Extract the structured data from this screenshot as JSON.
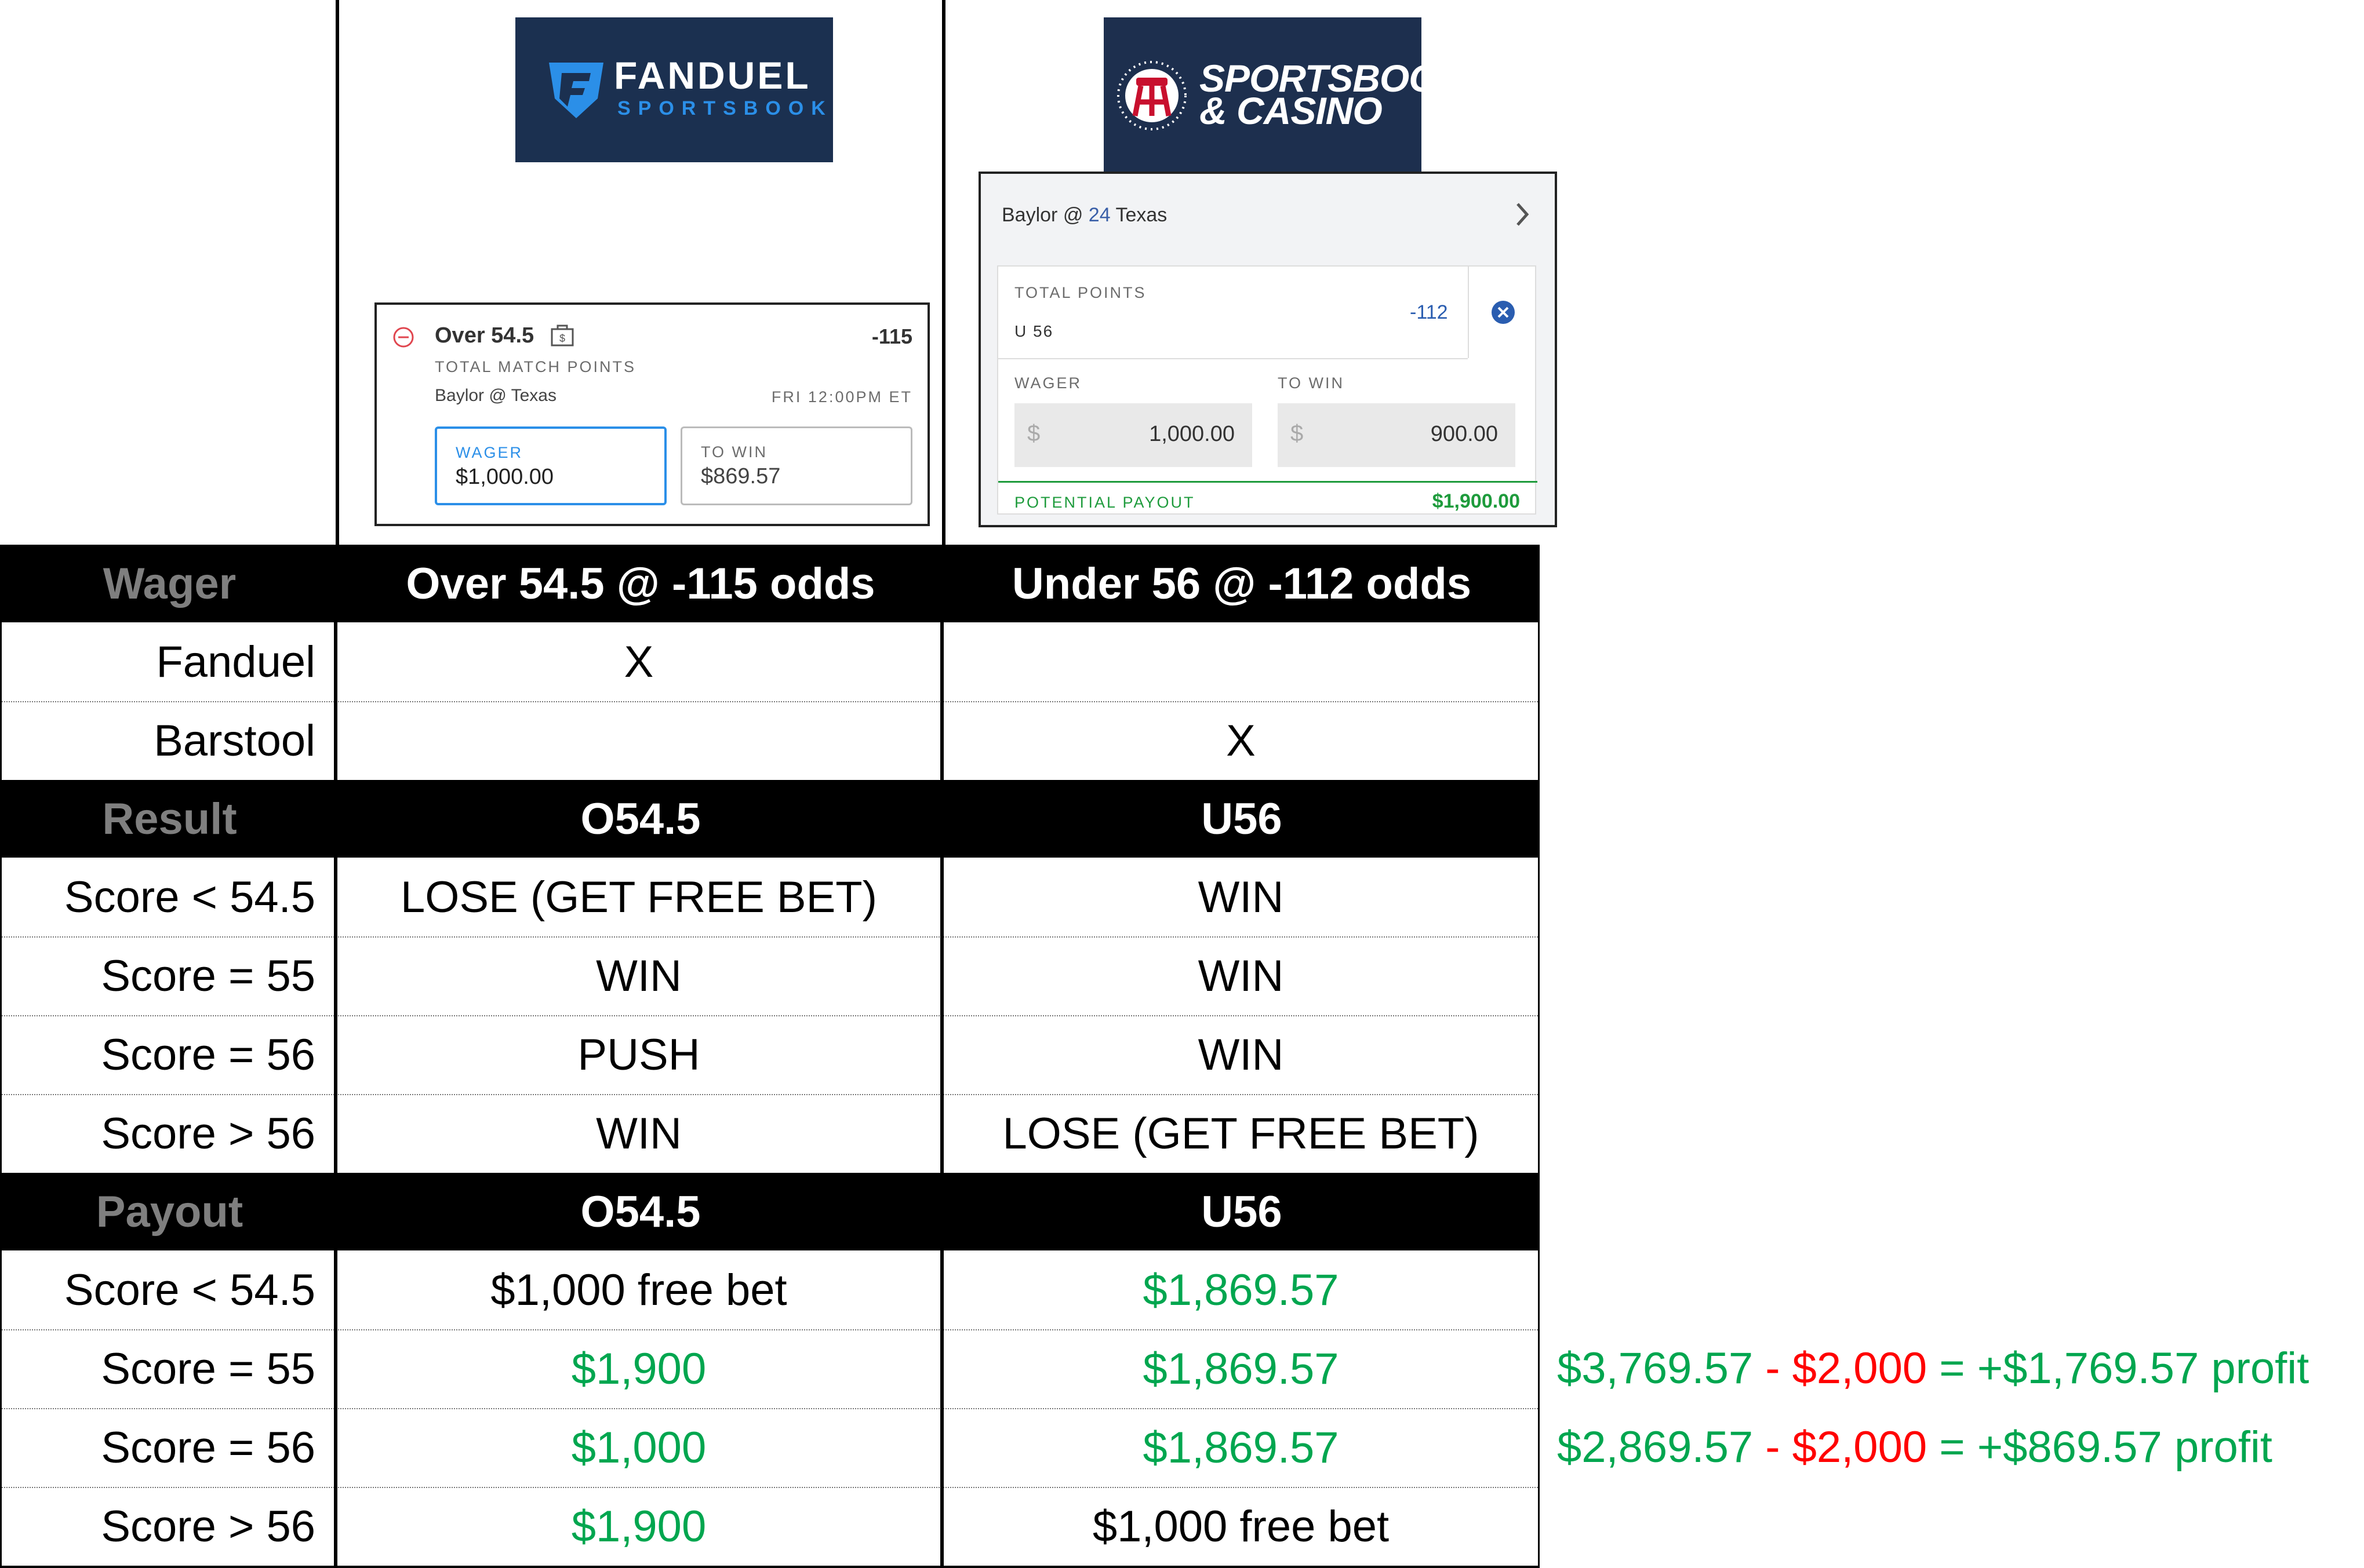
{
  "logos": {
    "fanduel": {
      "line1": "FANDUEL",
      "line2": "SPORTSBOOK"
    },
    "barstool": {
      "line1": "SPORTSBOOK",
      "line2": "& CASINO"
    }
  },
  "fanduel_slip": {
    "selection": "Over 54.5",
    "odds": "-115",
    "market": "TOTAL MATCH POINTS",
    "matchup": "Baylor @ Texas",
    "time": "FRI 12:00PM ET",
    "wager_label": "WAGER",
    "wager_value": "$1,000.00",
    "towin_label": "TO WIN",
    "towin_value": "$869.57"
  },
  "barstool_slip": {
    "matchup_team1": "Baylor @",
    "matchup_rank": "24",
    "matchup_team2": "Texas",
    "market": "TOTAL POINTS",
    "selection": "U 56",
    "odds": "-112",
    "wager_label": "WAGER",
    "towin_label": "TO WIN",
    "currency": "$",
    "wager_value": "1,000.00",
    "towin_value": "900.00",
    "payout_label": "POTENTIAL PAYOUT",
    "payout_value": "$1,900.00"
  },
  "table": {
    "wager_header": {
      "label": "Wager",
      "col1": "Over 54.5 @ -115 odds",
      "col2": "Under 56 @ -112 odds"
    },
    "book_rows": [
      {
        "label": "Fanduel",
        "col1": "X",
        "col2": ""
      },
      {
        "label": "Barstool",
        "col1": "",
        "col2": "X"
      }
    ],
    "result_header": {
      "label": "Result",
      "col1": "O54.5",
      "col2": "U56"
    },
    "result_rows": [
      {
        "label": "Score < 54.5",
        "col1": "LOSE (GET FREE BET)",
        "col2": "WIN"
      },
      {
        "label": "Score = 55",
        "col1": "WIN",
        "col2": "WIN"
      },
      {
        "label": "Score = 56",
        "col1": "PUSH",
        "col2": "WIN"
      },
      {
        "label": "Score > 56",
        "col1": "WIN",
        "col2": "LOSE (GET FREE BET)"
      }
    ],
    "payout_header": {
      "label": "Payout",
      "col1": "O54.5",
      "col2": "U56"
    },
    "payout_rows": [
      {
        "label": "Score < 54.5",
        "col1": "$1,000 free bet",
        "col2": "$1,869.57"
      },
      {
        "label": "Score = 55",
        "col1": "$1,900",
        "col2": "$1,869.57"
      },
      {
        "label": "Score = 56",
        "col1": "$1,000",
        "col2": "$1,869.57"
      },
      {
        "label": "Score > 56",
        "col1": "$1,900",
        "col2": "$1,000 free bet"
      }
    ]
  },
  "profit_notes": [
    {
      "total": "$3,769.57",
      "minus": " - ",
      "cost": "$2,000",
      "result": " = +$1,769.57 profit"
    },
    {
      "total": "$2,869.57",
      "minus": " - ",
      "cost": "$2,000",
      "result": " = +$869.57 profit"
    }
  ],
  "colors": {
    "win_green": "#00a64f",
    "cost_red": "#ff0000",
    "logo_navy": "#1b3050",
    "fanduel_blue": "#2b8fe8",
    "barstool_green": "#1e9b3c"
  }
}
